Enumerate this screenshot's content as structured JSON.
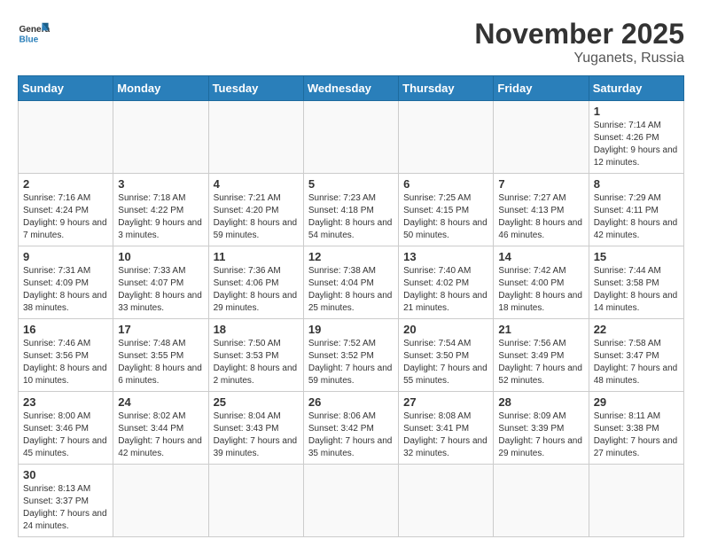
{
  "header": {
    "logo_general": "General",
    "logo_blue": "Blue",
    "month_title": "November 2025",
    "location": "Yuganets, Russia"
  },
  "weekdays": [
    "Sunday",
    "Monday",
    "Tuesday",
    "Wednesday",
    "Thursday",
    "Friday",
    "Saturday"
  ],
  "weeks": [
    [
      {
        "day": "",
        "content": ""
      },
      {
        "day": "",
        "content": ""
      },
      {
        "day": "",
        "content": ""
      },
      {
        "day": "",
        "content": ""
      },
      {
        "day": "",
        "content": ""
      },
      {
        "day": "",
        "content": ""
      },
      {
        "day": "1",
        "content": "Sunrise: 7:14 AM\nSunset: 4:26 PM\nDaylight: 9 hours and 12 minutes."
      }
    ],
    [
      {
        "day": "2",
        "content": "Sunrise: 7:16 AM\nSunset: 4:24 PM\nDaylight: 9 hours and 7 minutes."
      },
      {
        "day": "3",
        "content": "Sunrise: 7:18 AM\nSunset: 4:22 PM\nDaylight: 9 hours and 3 minutes."
      },
      {
        "day": "4",
        "content": "Sunrise: 7:21 AM\nSunset: 4:20 PM\nDaylight: 8 hours and 59 minutes."
      },
      {
        "day": "5",
        "content": "Sunrise: 7:23 AM\nSunset: 4:18 PM\nDaylight: 8 hours and 54 minutes."
      },
      {
        "day": "6",
        "content": "Sunrise: 7:25 AM\nSunset: 4:15 PM\nDaylight: 8 hours and 50 minutes."
      },
      {
        "day": "7",
        "content": "Sunrise: 7:27 AM\nSunset: 4:13 PM\nDaylight: 8 hours and 46 minutes."
      },
      {
        "day": "8",
        "content": "Sunrise: 7:29 AM\nSunset: 4:11 PM\nDaylight: 8 hours and 42 minutes."
      }
    ],
    [
      {
        "day": "9",
        "content": "Sunrise: 7:31 AM\nSunset: 4:09 PM\nDaylight: 8 hours and 38 minutes."
      },
      {
        "day": "10",
        "content": "Sunrise: 7:33 AM\nSunset: 4:07 PM\nDaylight: 8 hours and 33 minutes."
      },
      {
        "day": "11",
        "content": "Sunrise: 7:36 AM\nSunset: 4:06 PM\nDaylight: 8 hours and 29 minutes."
      },
      {
        "day": "12",
        "content": "Sunrise: 7:38 AM\nSunset: 4:04 PM\nDaylight: 8 hours and 25 minutes."
      },
      {
        "day": "13",
        "content": "Sunrise: 7:40 AM\nSunset: 4:02 PM\nDaylight: 8 hours and 21 minutes."
      },
      {
        "day": "14",
        "content": "Sunrise: 7:42 AM\nSunset: 4:00 PM\nDaylight: 8 hours and 18 minutes."
      },
      {
        "day": "15",
        "content": "Sunrise: 7:44 AM\nSunset: 3:58 PM\nDaylight: 8 hours and 14 minutes."
      }
    ],
    [
      {
        "day": "16",
        "content": "Sunrise: 7:46 AM\nSunset: 3:56 PM\nDaylight: 8 hours and 10 minutes."
      },
      {
        "day": "17",
        "content": "Sunrise: 7:48 AM\nSunset: 3:55 PM\nDaylight: 8 hours and 6 minutes."
      },
      {
        "day": "18",
        "content": "Sunrise: 7:50 AM\nSunset: 3:53 PM\nDaylight: 8 hours and 2 minutes."
      },
      {
        "day": "19",
        "content": "Sunrise: 7:52 AM\nSunset: 3:52 PM\nDaylight: 7 hours and 59 minutes."
      },
      {
        "day": "20",
        "content": "Sunrise: 7:54 AM\nSunset: 3:50 PM\nDaylight: 7 hours and 55 minutes."
      },
      {
        "day": "21",
        "content": "Sunrise: 7:56 AM\nSunset: 3:49 PM\nDaylight: 7 hours and 52 minutes."
      },
      {
        "day": "22",
        "content": "Sunrise: 7:58 AM\nSunset: 3:47 PM\nDaylight: 7 hours and 48 minutes."
      }
    ],
    [
      {
        "day": "23",
        "content": "Sunrise: 8:00 AM\nSunset: 3:46 PM\nDaylight: 7 hours and 45 minutes."
      },
      {
        "day": "24",
        "content": "Sunrise: 8:02 AM\nSunset: 3:44 PM\nDaylight: 7 hours and 42 minutes."
      },
      {
        "day": "25",
        "content": "Sunrise: 8:04 AM\nSunset: 3:43 PM\nDaylight: 7 hours and 39 minutes."
      },
      {
        "day": "26",
        "content": "Sunrise: 8:06 AM\nSunset: 3:42 PM\nDaylight: 7 hours and 35 minutes."
      },
      {
        "day": "27",
        "content": "Sunrise: 8:08 AM\nSunset: 3:41 PM\nDaylight: 7 hours and 32 minutes."
      },
      {
        "day": "28",
        "content": "Sunrise: 8:09 AM\nSunset: 3:39 PM\nDaylight: 7 hours and 29 minutes."
      },
      {
        "day": "29",
        "content": "Sunrise: 8:11 AM\nSunset: 3:38 PM\nDaylight: 7 hours and 27 minutes."
      }
    ],
    [
      {
        "day": "30",
        "content": "Sunrise: 8:13 AM\nSunset: 3:37 PM\nDaylight: 7 hours and 24 minutes."
      },
      {
        "day": "",
        "content": ""
      },
      {
        "day": "",
        "content": ""
      },
      {
        "day": "",
        "content": ""
      },
      {
        "day": "",
        "content": ""
      },
      {
        "day": "",
        "content": ""
      },
      {
        "day": "",
        "content": ""
      }
    ]
  ]
}
